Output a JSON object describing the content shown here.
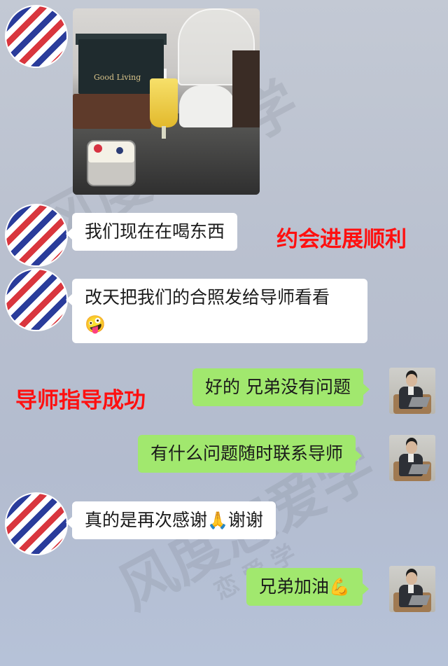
{
  "photo": {
    "box_label": "Good Living"
  },
  "messages": [
    {
      "id": "m1",
      "text": "我们现在在喝东西",
      "emoji": ""
    },
    {
      "id": "m2",
      "text": "改天把我们的合照发给导师看看",
      "emoji": "🤪"
    },
    {
      "id": "m3",
      "text": "好的 兄弟没有问题",
      "emoji": ""
    },
    {
      "id": "m4",
      "text": "有什么问题随时联系导师",
      "emoji": ""
    },
    {
      "id": "m5",
      "text_before": "真的是再次感谢",
      "emoji": "🙏",
      "text_after": "谢谢"
    },
    {
      "id": "m6",
      "text": "兄弟加油",
      "emoji": "💪"
    }
  ],
  "annotations": {
    "date_progress": "约会进展顺利",
    "mentor_success": "导师指导成功"
  },
  "watermark": {
    "main": "风度恋爱学",
    "small": "恋 爱 学"
  },
  "colors": {
    "bubble_self": "#a1e86e",
    "bubble_other": "#ffffff",
    "annotation": "#ff1010"
  }
}
